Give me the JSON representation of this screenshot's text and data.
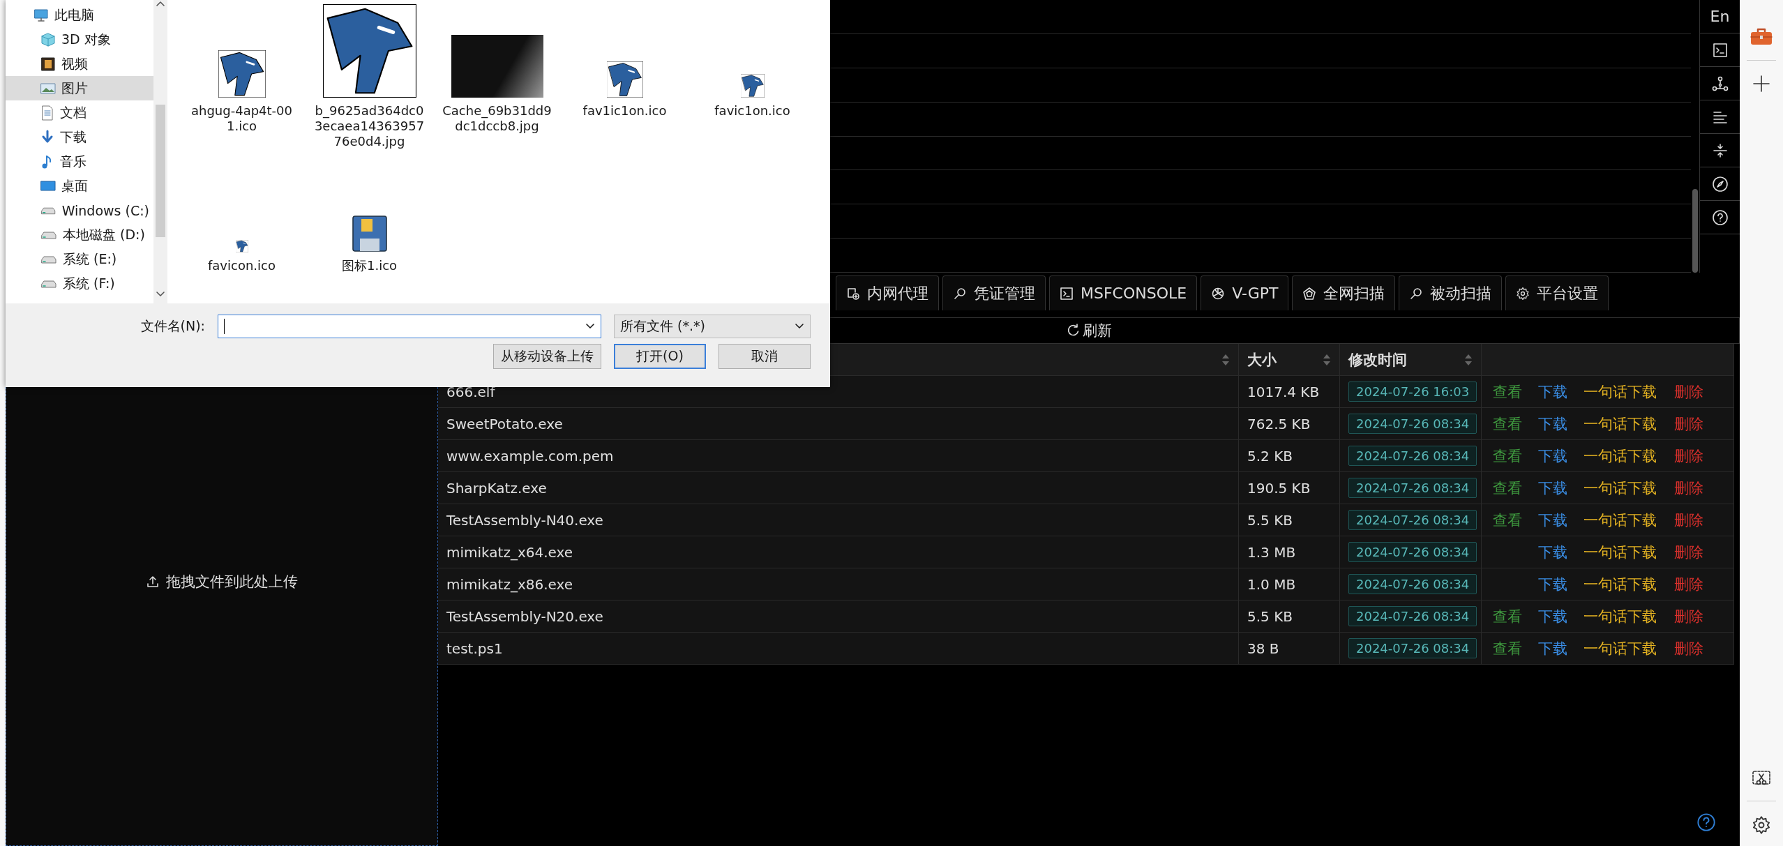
{
  "side_toolbar": {
    "language": "En"
  },
  "tabs": [
    {
      "label": "内网代理",
      "kind": "proxy",
      "selected": false
    },
    {
      "label": "凭证管理",
      "kind": "key",
      "selected": false
    },
    {
      "label": "MSFCONSOLE",
      "kind": "terminal",
      "selected": false
    },
    {
      "label": "V-GPT",
      "kind": "gpt",
      "selected": false
    },
    {
      "label": "全网扫描",
      "kind": "pentagon",
      "selected": false
    },
    {
      "label": "被动扫描",
      "kind": "key",
      "selected": false
    },
    {
      "label": "平台设置",
      "kind": "gear",
      "selected": false
    }
  ],
  "upload": {
    "label": "拖拽文件到此处上传"
  },
  "refresh": {
    "label": "刷新"
  },
  "table": {
    "columns": [
      "大小",
      "修改时间"
    ],
    "rows": [
      {
        "name": "666.elf",
        "size": "1017.4 KB",
        "time": "2024-07-26 16:03",
        "actions": [
          {
            "label": "查看",
            "kind": "view"
          },
          {
            "label": "下载",
            "kind": "download"
          },
          {
            "label": "一句话下载",
            "kind": "oneliner"
          },
          {
            "label": "删除",
            "kind": "delete"
          }
        ]
      },
      {
        "name": "SweetPotato.exe",
        "size": "762.5 KB",
        "time": "2024-07-26 08:34",
        "actions": [
          {
            "label": "查看",
            "kind": "view"
          },
          {
            "label": "下载",
            "kind": "download"
          },
          {
            "label": "一句话下载",
            "kind": "oneliner"
          },
          {
            "label": "删除",
            "kind": "delete"
          }
        ]
      },
      {
        "name": "www.example.com.pem",
        "size": "5.2 KB",
        "time": "2024-07-26 08:34",
        "actions": [
          {
            "label": "查看",
            "kind": "view"
          },
          {
            "label": "下载",
            "kind": "download"
          },
          {
            "label": "一句话下载",
            "kind": "oneliner"
          },
          {
            "label": "删除",
            "kind": "delete"
          }
        ]
      },
      {
        "name": "SharpKatz.exe",
        "size": "190.5 KB",
        "time": "2024-07-26 08:34",
        "actions": [
          {
            "label": "查看",
            "kind": "view"
          },
          {
            "label": "下载",
            "kind": "download"
          },
          {
            "label": "一句话下载",
            "kind": "oneliner"
          },
          {
            "label": "删除",
            "kind": "delete"
          }
        ]
      },
      {
        "name": "TestAssembly-N40.exe",
        "size": "5.5 KB",
        "time": "2024-07-26 08:34",
        "actions": [
          {
            "label": "查看",
            "kind": "view"
          },
          {
            "label": "下载",
            "kind": "download"
          },
          {
            "label": "一句话下载",
            "kind": "oneliner"
          },
          {
            "label": "删除",
            "kind": "delete"
          }
        ]
      },
      {
        "name": "mimikatz_x64.exe",
        "size": "1.3 MB",
        "time": "2024-07-26 08:34",
        "actions": [
          {
            "label": "下载",
            "kind": "download"
          },
          {
            "label": "一句话下载",
            "kind": "oneliner"
          },
          {
            "label": "删除",
            "kind": "delete"
          }
        ]
      },
      {
        "name": "mimikatz_x86.exe",
        "size": "1.0 MB",
        "time": "2024-07-26 08:34",
        "actions": [
          {
            "label": "下载",
            "kind": "download"
          },
          {
            "label": "一句话下载",
            "kind": "oneliner"
          },
          {
            "label": "删除",
            "kind": "delete"
          }
        ]
      },
      {
        "name": "TestAssembly-N20.exe",
        "size": "5.5 KB",
        "time": "2024-07-26 08:34",
        "actions": [
          {
            "label": "查看",
            "kind": "view"
          },
          {
            "label": "下载",
            "kind": "download"
          },
          {
            "label": "一句话下载",
            "kind": "oneliner"
          },
          {
            "label": "删除",
            "kind": "delete"
          }
        ]
      },
      {
        "name": "test.ps1",
        "size": "38 B",
        "time": "2024-07-26 08:34",
        "actions": [
          {
            "label": "查看",
            "kind": "view"
          },
          {
            "label": "下载",
            "kind": "download"
          },
          {
            "label": "一句话下载",
            "kind": "oneliner"
          },
          {
            "label": "删除",
            "kind": "delete"
          }
        ]
      }
    ]
  },
  "dialog": {
    "nav_items": [
      {
        "label": "此电脑",
        "kind": "computer",
        "selected": false
      },
      {
        "label": "3D 对象",
        "kind": "cube",
        "selected": false
      },
      {
        "label": "视频",
        "kind": "film",
        "selected": false
      },
      {
        "label": "图片",
        "kind": "picture",
        "selected": true
      },
      {
        "label": "文档",
        "kind": "document",
        "selected": false
      },
      {
        "label": "下载",
        "kind": "download",
        "selected": false
      },
      {
        "label": "音乐",
        "kind": "music",
        "selected": false
      },
      {
        "label": "桌面",
        "kind": "desktop",
        "selected": false
      },
      {
        "label": "Windows (C:)",
        "kind": "drive",
        "selected": false
      },
      {
        "label": "本地磁盘 (D:)",
        "kind": "drive",
        "selected": false
      },
      {
        "label": "系统 (E:)",
        "kind": "drive",
        "selected": false
      },
      {
        "label": "系统 (F:)",
        "kind": "drive",
        "selected": false
      }
    ],
    "files": [
      {
        "name": "ahgug-4ap4t-001.ico",
        "kind": "logo-medium"
      },
      {
        "name": "b_9625ad364dc03ecaea1436395776e0d4.jpg",
        "kind": "logo-large"
      },
      {
        "name": "Cache_69b31dd9dc1dccb8.jpg",
        "kind": "photo"
      },
      {
        "name": "fav1ic1on.ico",
        "kind": "logo-small"
      },
      {
        "name": "favic1on.ico",
        "kind": "logo-tiny"
      },
      {
        "name": "favicon.ico",
        "kind": "logo-mini"
      },
      {
        "name": "图标1.ico",
        "kind": "floppy"
      }
    ],
    "file_name_label": "文件名(N):",
    "file_type": "所有文件 (*.*)",
    "buttons": [
      {
        "label": "从移动设备上传",
        "kind": "normal"
      },
      {
        "label": "打开(O)",
        "kind": "default"
      },
      {
        "label": "取消",
        "kind": "normal"
      }
    ]
  }
}
